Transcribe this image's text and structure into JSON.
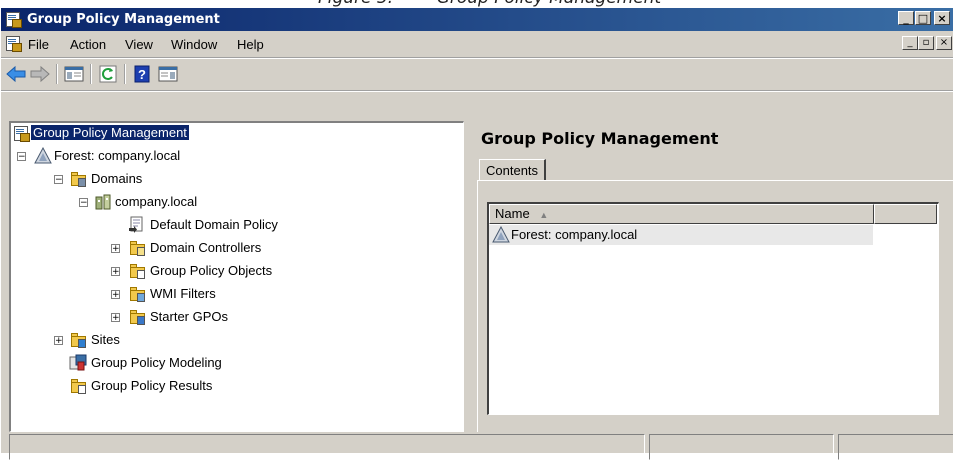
{
  "caption": "Figure 5:        Group Policy Management",
  "window": {
    "title": "Group Policy Management",
    "caption_buttons": [
      "minimize",
      "maximize",
      "close"
    ]
  },
  "menubar": {
    "items": [
      "File",
      "Action",
      "View",
      "Window",
      "Help"
    ]
  },
  "toolbar": {
    "buttons": [
      "back-icon",
      "forward-icon",
      "show-hide-tree-icon",
      "refresh-icon",
      "help-icon",
      "console-tree-icon"
    ]
  },
  "tree": {
    "root": "Group Policy Management",
    "forest": "Forest: company.local",
    "domains": "Domains",
    "domain": "company.local",
    "default_policy": "Default Domain Policy",
    "domain_controllers": "Domain Controllers",
    "gpo": "Group Policy Objects",
    "wmi": "WMI Filters",
    "starter": "Starter GPOs",
    "sites": "Sites",
    "modeling": "Group Policy Modeling",
    "results": "Group Policy Results"
  },
  "details": {
    "title": "Group Policy Management",
    "tab": "Contents",
    "columns": [
      "Name"
    ],
    "sort_indicator": "▲",
    "rows": [
      "Forest: company.local"
    ]
  },
  "colors": {
    "titlebar_start": "#0a246a",
    "titlebar_end": "#3a6ea5",
    "selection": "#0a246a",
    "chrome": "#d4d0c8"
  }
}
